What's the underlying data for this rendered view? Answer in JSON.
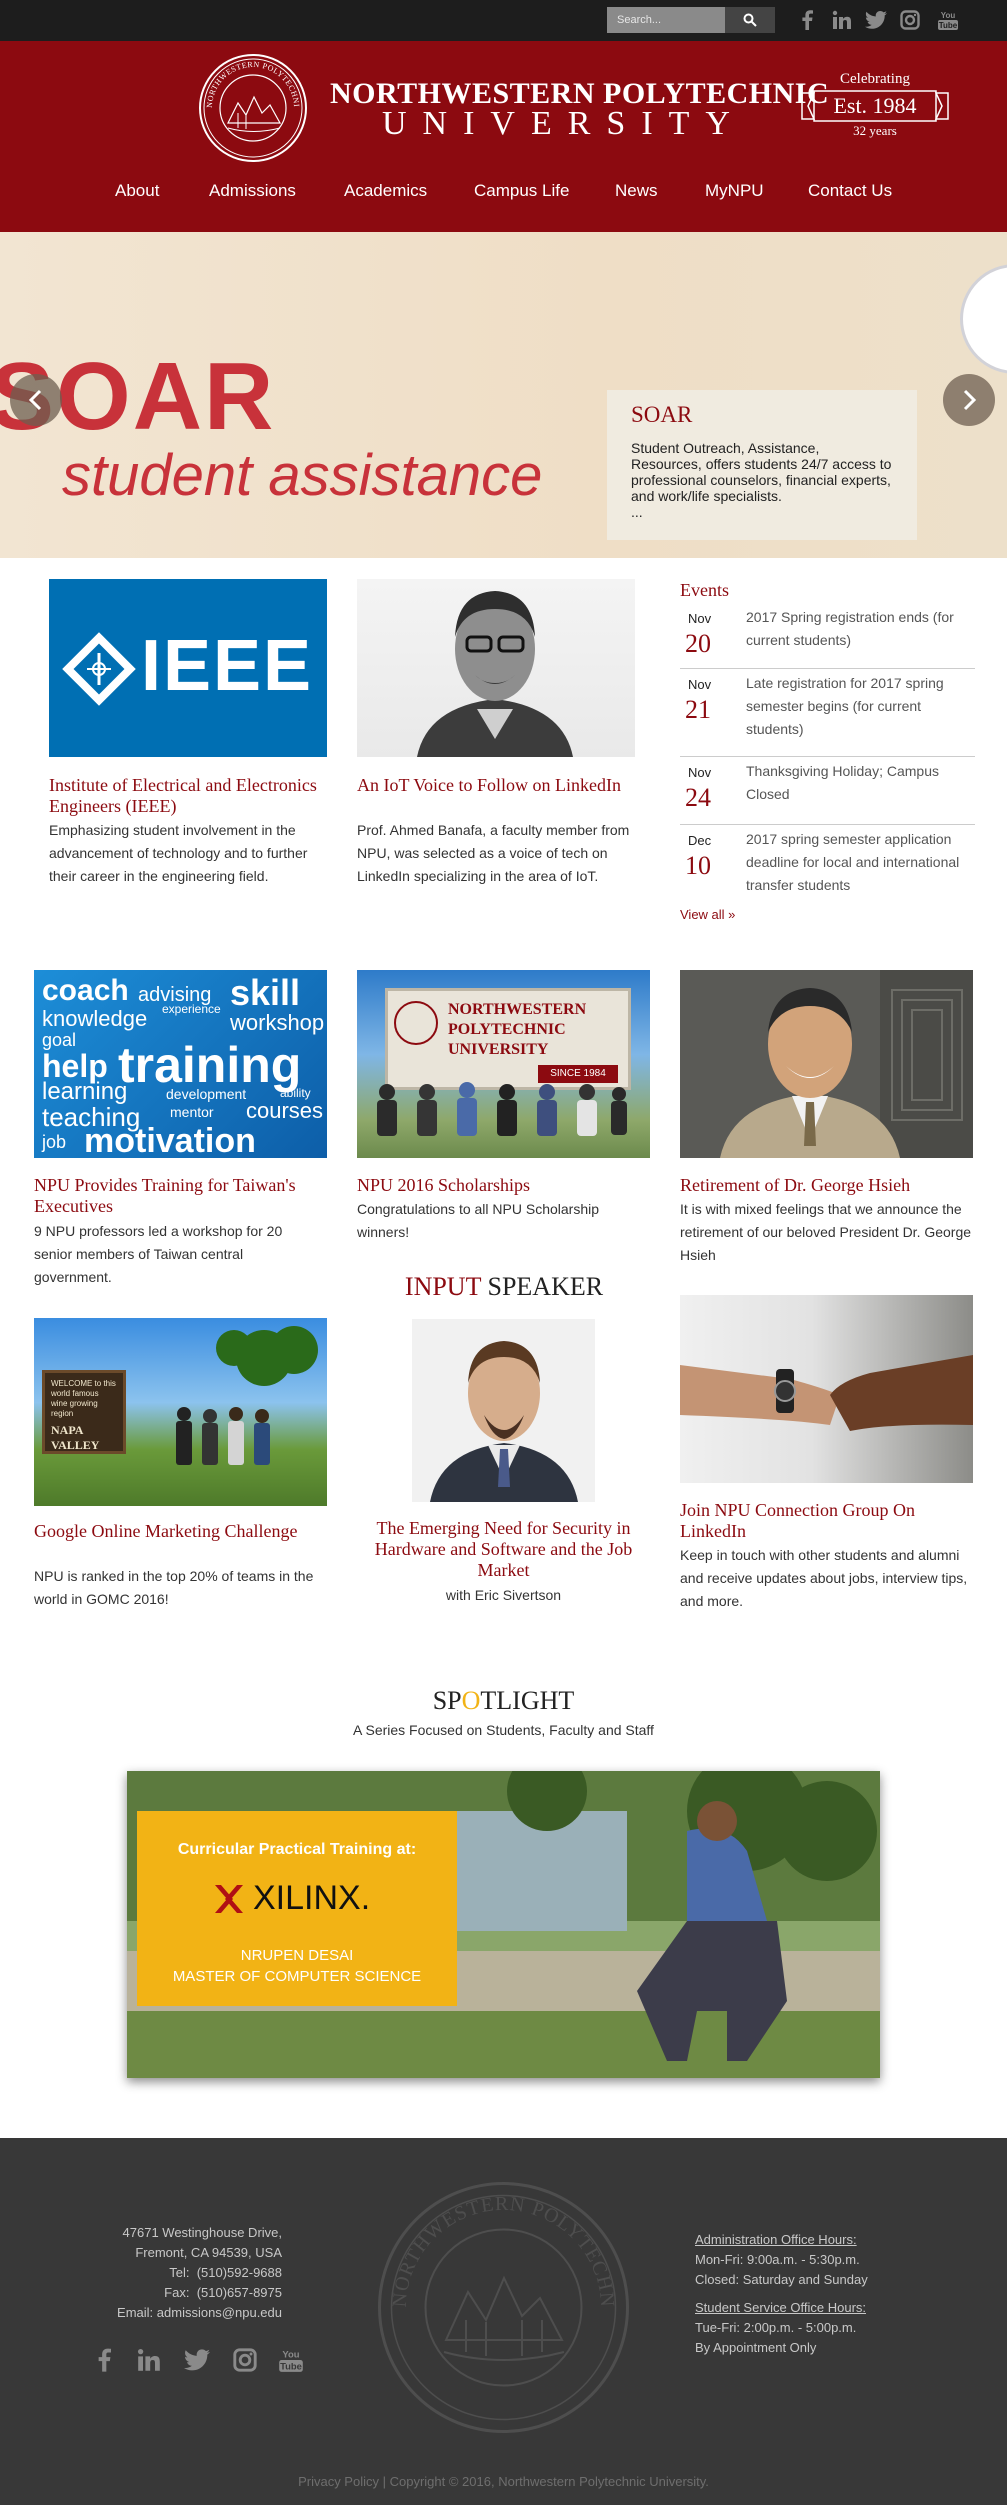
{
  "search": {
    "placeholder": "Search..."
  },
  "social_icons": [
    "facebook-icon",
    "linkedin-icon",
    "twitter-icon",
    "instagram-icon",
    "youtube-icon"
  ],
  "header": {
    "name_line1": "NORTHWESTERN POLYTECHNIC",
    "name_line2": "UNIVERSITY",
    "celebrating": "Celebrating",
    "established": "Est. 1984",
    "years": "32 years",
    "seal_text": "NORTHWESTERN POLYTECHNIC UNIVERSITY"
  },
  "nav": {
    "items": [
      "About",
      "Admissions",
      "Academics",
      "Campus Life",
      "News",
      "MyNPU",
      "Contact Us"
    ]
  },
  "hero": {
    "headline": "SOAR",
    "tagline": "student assistance",
    "caption_title": "SOAR",
    "caption_text": "Student Outreach, Assistance, Resources, offers students 24/7 access to professional counselors, financial experts, and work/life specialists.",
    "caption_more": "..."
  },
  "cards": {
    "ieee": {
      "logo_text": "IEEE",
      "title": "Institute of Electrical and Electronics Engineers (IEEE)",
      "text": "Emphasizing student involvement in the advancement of technology and to further their career in the engineering field."
    },
    "iot": {
      "title": "An IoT Voice to Follow on LinkedIn",
      "text": "Prof. Ahmed Banafa, a faculty member from NPU, was selected as a voice of tech on LinkedIn specializing in the area of IoT."
    },
    "training": {
      "title": "NPU Provides Training for Taiwan's Executives",
      "text": "9 NPU professors led a workshop for 20 senior members of Taiwan central government.",
      "words": [
        "coach",
        "advising",
        "skill",
        "knowledge",
        "experience",
        "workshop",
        "goal",
        "help",
        "training",
        "learning",
        "development",
        "ability",
        "teaching",
        "mentor",
        "courses",
        "job",
        "motivation"
      ]
    },
    "scholarships": {
      "title": "NPU 2016 Scholarships",
      "text": "Congratulations to all NPU Scholarship winners!",
      "sign_line1": "NORTHWESTERN",
      "sign_line2": "POLYTECHNIC",
      "sign_line3": "UNIVERSITY",
      "sign_since": "SINCE 1984"
    },
    "retirement": {
      "title": "Retirement of Dr. George Hsieh",
      "text": "It is with mixed feelings that we announce the retirement of our beloved President Dr. George Hsieh"
    },
    "google": {
      "title": "Google Online Marketing Challenge",
      "text": "NPU is ranked in the top 20% of teams in the world in GOMC 2016!",
      "sign_text": "WELCOME to this world famous wine growing region",
      "sign_name": "NAPA VALLEY"
    },
    "speaker": {
      "heading_first": "INPUT",
      "heading_second": "SPEAKER",
      "title": "The Emerging Need for Security in Hardware and Software and the Job Market",
      "subtitle": "with Eric Sivertson"
    },
    "linkedin_group": {
      "title": "Join NPU Connection Group On LinkedIn",
      "text": "Keep in touch with other students and alumni and receive updates about jobs, interview tips, and more."
    }
  },
  "events": {
    "title": "Events",
    "items": [
      {
        "month": "Nov",
        "day": "20",
        "text": "2017 Spring registration ends (for current students)"
      },
      {
        "month": "Nov",
        "day": "21",
        "text": "Late registration for 2017 spring semester begins (for current students)"
      },
      {
        "month": "Nov",
        "day": "24",
        "text": "Thanksgiving Holiday; Campus Closed"
      },
      {
        "month": "Dec",
        "day": "10",
        "text": "2017 spring semester application deadline for local and international transfer students"
      }
    ],
    "view_all": "View all »"
  },
  "spotlight": {
    "title_sp": "SP",
    "title_o": "O",
    "title_rest": "TLIGHT",
    "subtitle": "A Series Focused on Students, Faculty and Staff",
    "card_heading": "Curricular Practical Training at:",
    "company": "XILINX.",
    "person": "NRUPEN DESAI",
    "degree": "MASTER OF COMPUTER SCIENCE"
  },
  "footer": {
    "address": [
      "47671 Westinghouse Drive,",
      "Fremont, CA 94539, USA"
    ],
    "tel_label": "Tel:",
    "tel": "(510)592-9688",
    "fax_label": "Fax:",
    "fax": "(510)657-8975",
    "email_label": "Email:",
    "email": "admissions@npu.edu",
    "admin_hours_title": "Administration Office Hours:",
    "admin_hours": [
      "Mon-Fri: 9:00a.m. - 5:30p.m.",
      "Closed: Saturday and Sunday"
    ],
    "service_hours_title": "Student Service Office Hours:",
    "service_hours": [
      "Tue-Fri: 2:00p.m. - 5:00p.m.",
      "By Appointment Only"
    ],
    "privacy": "Privacy Policy",
    "copyright": "| Copyright © 2016, Northwestern Polytechnic University."
  },
  "colors": {
    "brand_red": "#8c0a10",
    "topbar": "#1d1d1d",
    "footer": "#383838",
    "spotlight_yellow": "#f2b315"
  }
}
